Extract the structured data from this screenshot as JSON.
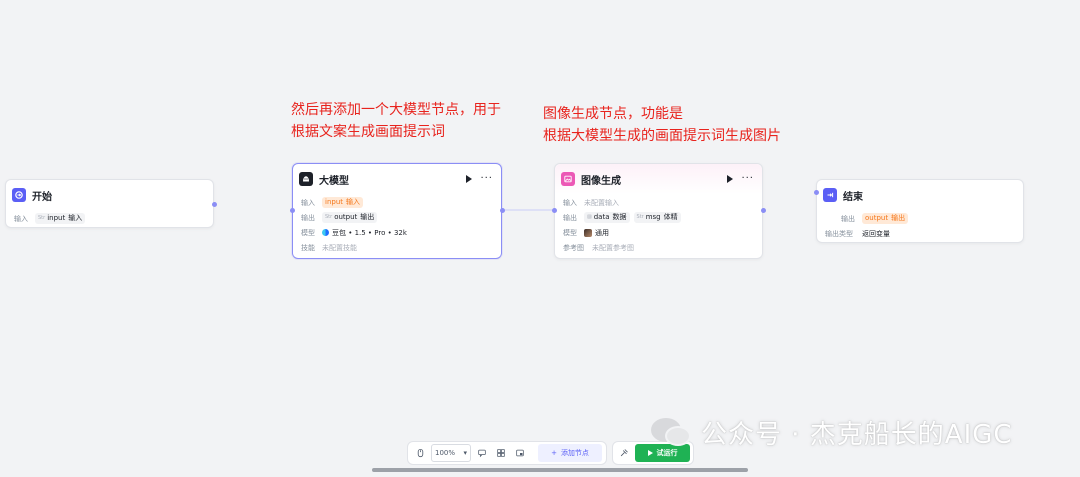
{
  "annotations": {
    "left_line1": "然后再添加一个大模型节点，用于",
    "left_line2": "根据文案生成画面提示词",
    "right_line1": "图像生成节点，功能是",
    "right_line2": "根据大模型生成的画面提示词生成图片",
    "color": "#e8231d"
  },
  "nodes": {
    "start": {
      "title": "开始",
      "icon": "start-icon",
      "input_label": "输入",
      "input_type": "Str",
      "input_name": "input",
      "input_desc": "输入"
    },
    "llm": {
      "title": "大模型",
      "icon": "llm-icon",
      "input_label": "输入",
      "input_name": "input",
      "input_desc": "输入",
      "output_label": "输出",
      "output_type": "Str",
      "output_name": "output",
      "output_desc": "输出",
      "model_label": "模型",
      "model_value": "豆包 • 1.5 • Pro • 32k",
      "skill_label": "技能",
      "skill_value": "未配置技能"
    },
    "image": {
      "title": "图像生成",
      "icon": "image-gen-icon",
      "input_label": "输入",
      "input_value": "未配置输入",
      "output_label": "输出",
      "output1_name": "data",
      "output1_desc": "数据",
      "output2_type": "Str",
      "output2_name": "msg",
      "output2_desc": "体精",
      "model_label": "模型",
      "model_value": "通用",
      "ref_label": "参考图",
      "ref_value": "未配置参考图"
    },
    "end": {
      "title": "结束",
      "icon": "end-icon",
      "output_label": "输出",
      "output_name": "output",
      "output_desc": "输出",
      "output_type_label": "输出类型",
      "output_type_value": "返回变量"
    }
  },
  "toolbar": {
    "zoom": "100%",
    "add_node": "添加节点",
    "run": "试运行",
    "run_color": "#1fb254",
    "accent": "#5b5ff5"
  },
  "watermark": {
    "text": "公众号 · 杰克船长的AIGC"
  }
}
